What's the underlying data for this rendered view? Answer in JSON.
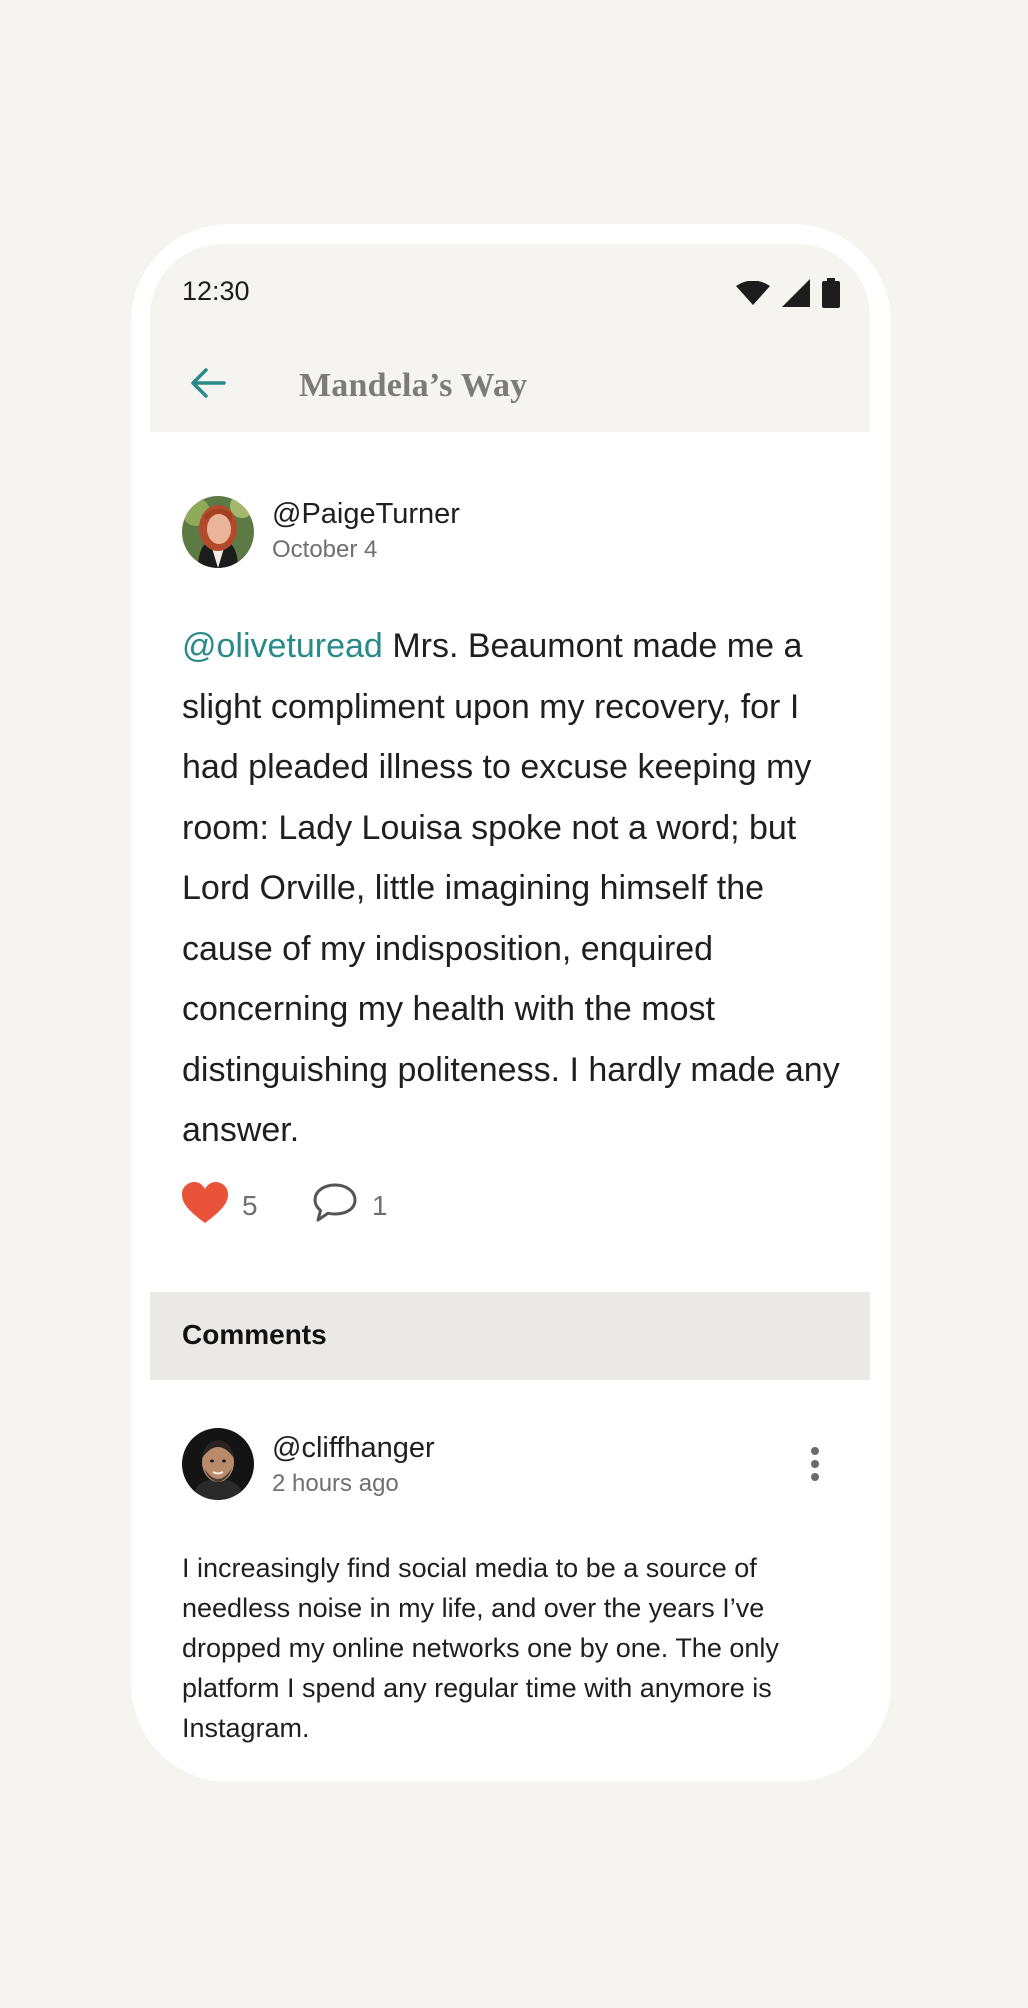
{
  "status_bar": {
    "time": "12:30",
    "icons": [
      "wifi-icon",
      "cell-signal-icon",
      "battery-icon"
    ]
  },
  "top_bar": {
    "back_icon": "arrow-left-icon",
    "title": "Mandela’s Way"
  },
  "post": {
    "username": "@PaigeTurner",
    "date": "October 4",
    "mention": "@oliveturead",
    "text": "Mrs. Beaumont made me a slight compliment upon my recovery, for I had pleaded illness to excuse keeping my room: Lady Louisa spoke not a word; but Lord Orville, little imagining himself the cause of my indisposition, enquired concerning my health with the most distinguishing politeness. I hardly made any answer.",
    "likes": "5",
    "comments": "1"
  },
  "comments_section": {
    "title": "Comments",
    "items": [
      {
        "username": "@cliffhanger",
        "time": "2 hours ago",
        "text": "I increasingly find social media to be a source of needless noise in my life, and over the years I’ve dropped my online networks one by one. The only platform I spend any regular time with anymore is Instagram."
      }
    ]
  },
  "colors": {
    "accent": "#2a8a8a",
    "like": "#e8533a",
    "background": "#f5f4f1",
    "section_header": "#eae9e5"
  }
}
